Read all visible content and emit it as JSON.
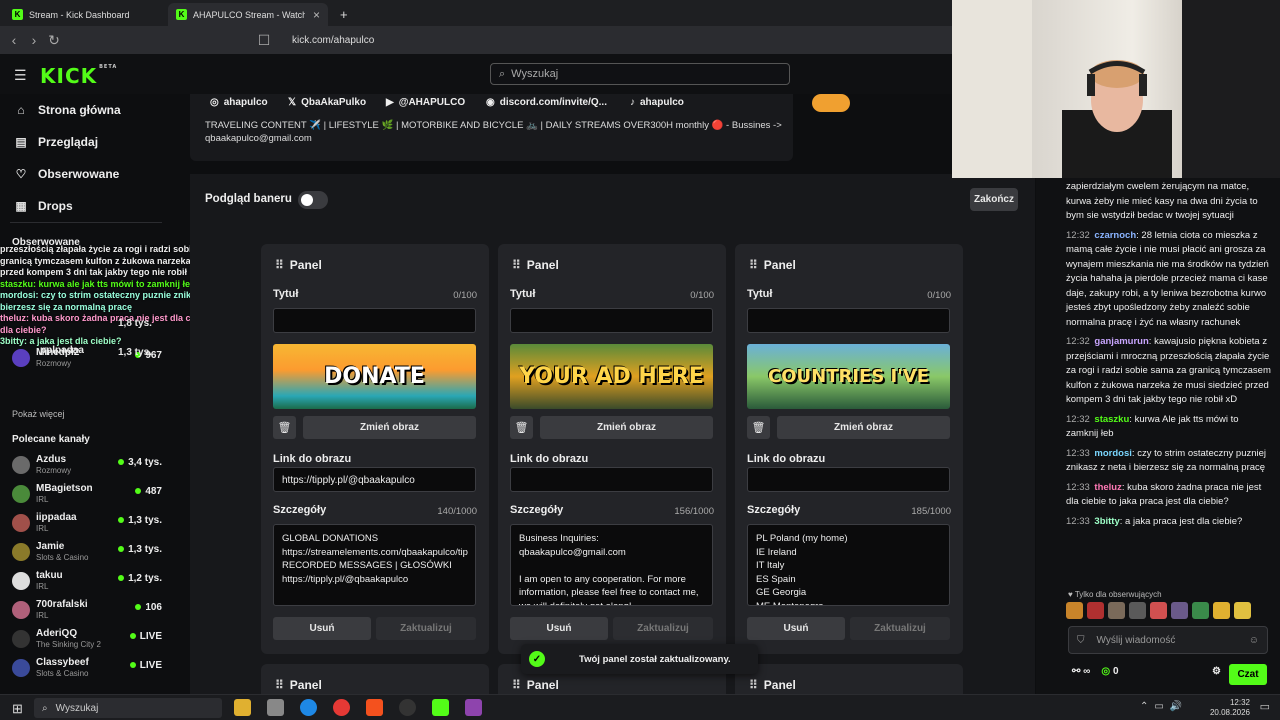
{
  "browser": {
    "tabs": [
      {
        "label": "Stream - Kick Dashboard"
      },
      {
        "label": "AHAPULCO Stream - Watch Live"
      }
    ],
    "url": "kick.com/ahapulco"
  },
  "header": {
    "logo": "KICK",
    "logo_badge": "BETA",
    "search_placeholder": "Wyszukaj"
  },
  "sidebar": {
    "nav": [
      {
        "label": "Strona główna",
        "icon": "home-icon"
      },
      {
        "label": "Przeglądaj",
        "icon": "browse-icon"
      },
      {
        "label": "Obserwowane",
        "icon": "heart-icon"
      },
      {
        "label": "Drops",
        "icon": "drops-icon"
      }
    ],
    "followed_title": "Obserwowane",
    "followed": [
      {
        "name": "Minedpl2",
        "category": "Rozmowy",
        "viewers": "967"
      }
    ],
    "show_more": "Pokaż więcej",
    "recommended_title": "Polecane kanały",
    "recommended": [
      {
        "name": "Azdus",
        "category": "Rozmowy",
        "viewers": "3,4 tys."
      },
      {
        "name": "MBagietson",
        "category": "IRL",
        "viewers": "487"
      },
      {
        "name": "iippadaa",
        "category": "IRL",
        "viewers": "1,3 tys."
      },
      {
        "name": "Jamie",
        "category": "Slots & Casino",
        "viewers": "1,3 tys."
      },
      {
        "name": "takuu",
        "category": "IRL",
        "viewers": "1,2 tys."
      },
      {
        "name": "700rafalski",
        "category": "IRL",
        "viewers": "106"
      },
      {
        "name": "AderiQQ",
        "category": "The Sinking City 2",
        "viewers": "LIVE"
      },
      {
        "name": "Classybeef",
        "category": "Slots & Casino",
        "viewers": "LIVE"
      }
    ]
  },
  "overlay_chat": [
    "przeszłością złapała życie za rogi i radzi sobie sama za granicą tymczasem kulfon z żukowa narzeka że musi siedzieć przed kompem 3 dni tak jakby tego nie robił",
    "staszku: kurwa ale jak tts mówi to zamknij łeb",
    "mordosi: czy to strim ostateczny puznie znikasz z neta i bierzesz się za normalną pracę",
    "theluz: kuba skoro żadna praca nie jest dla ciebie to jaka jest dla ciebie?",
    "3bitty: a jaka jest dla ciebie?"
  ],
  "overlay_counts": [
    "1,8 tys.",
    "1,3 tys."
  ],
  "overlay_names": [
    "pplpadaa"
  ],
  "profile": {
    "socials": [
      "ahapulco",
      "QbaAkaPulko",
      "@AHAPULCO",
      "discord.com/invite/Q...",
      "ahapulco"
    ],
    "bio": "TRAVELING CONTENT ✈️ | LIFESTYLE 🌿 | MOTORBIKE AND BICYCLE 🚲 | DAILY STREAMS OVER300H monthly 🔴 - Bussines -> qbaakapulco@gmail.com"
  },
  "banner_preview": "Podgląd baneru",
  "finish": "Zakończ",
  "labels": {
    "panel": "Panel",
    "title": "Tytuł",
    "change_image": "Zmień obraz",
    "image_link": "Link do obrazu",
    "details": "Szczegóły",
    "delete": "Usuń",
    "update": "Zaktualizuj"
  },
  "panels": [
    {
      "title_count": "0/100",
      "image_text": "DONATE",
      "link": "https://tipply.pl/@qbaakapulco",
      "details_count": "140/1000",
      "details": "GLOBAL DONATIONS\nhttps://streamelements.com/qbaakapulco/tip\n RECORDED MESSAGES | GŁOSÓWKI\nhttps://tipply.pl/@qbaakapulco"
    },
    {
      "title_count": "0/100",
      "image_text": "YOUR AD HERE",
      "link": "",
      "details_count": "156/1000",
      "details": "Business Inquiries:\nqbaakapulco@gmail.com\n\nI am open to any cooperation. For more information, please feel free to contact me, we will definitely get along!"
    },
    {
      "title_count": "0/100",
      "image_text": "COUNTRIES I'VE",
      "link": "",
      "details_count": "185/1000",
      "details": "PL Poland (my home)\nIE Ireland\nIT Italy\nES Spain\nGE Georgia\nME Montenegro"
    }
  ],
  "toast": "Twój panel został zaktualizowany.",
  "chat": {
    "messages": [
      {
        "time": "",
        "user": "",
        "text": "zapierdziałym cwelem żerującym na matce, kurwa żeby nie mieć kasy na dwa dni życia to bym sie wstydził bedac w twojej sytuacji",
        "color": "#eee"
      },
      {
        "time": "12:32",
        "user": "czarnoch",
        "text": "28 letnia ciota co mieszka z mamą całe życie i nie musi płacić ani grosza za wynajem mieszkania nie ma środków na tydzień życia hahaha ja pierdole przecież mama ci kase daje, zakupy robi, a ty leniwa bezrobotna kurwo jesteś zbyt upośledzony żeby znaleźć sobie normalna pracę i żyć na własny rachunek",
        "color": "#8ab4ff"
      },
      {
        "time": "12:32",
        "user": "ganjamurun",
        "text": "kawajusio piękna kobieta z przejściami i mroczną przeszłością złapała życie za rogi i radzi sobie sama za granicą tymczasem kulfon z żukowa narzeka że musi siedzieć przed kompem 3 dni tak jakby tego nie robił xD",
        "color": "#c9a6ff"
      },
      {
        "time": "12:32",
        "user": "staszku",
        "text": "kurwa Ale jak tts mówi to zamknij łeb",
        "color": "#53fc18"
      },
      {
        "time": "12:33",
        "user": "mordosi",
        "text": "czy to strim ostateczny puzniej znikasz z neta i bierzesz się za normalną pracę",
        "color": "#7ad7ff"
      },
      {
        "time": "12:33",
        "user": "theluz",
        "text": "kuba skoro żadna praca nie jest dla ciebie to jaka praca jest dla ciebie?",
        "color": "#ff7ab5"
      },
      {
        "time": "12:33",
        "user": "3bitty",
        "text": "a jaka praca jest dla ciebie?",
        "color": "#9effc8"
      }
    ],
    "followers_only": "Tylko dla obserwujących",
    "input_placeholder": "Wyślij wiadomość",
    "points": "0",
    "send": "Czat"
  },
  "taskbar": {
    "search": "Wyszukaj",
    "time": "12:32",
    "date": "20.08.2026"
  }
}
